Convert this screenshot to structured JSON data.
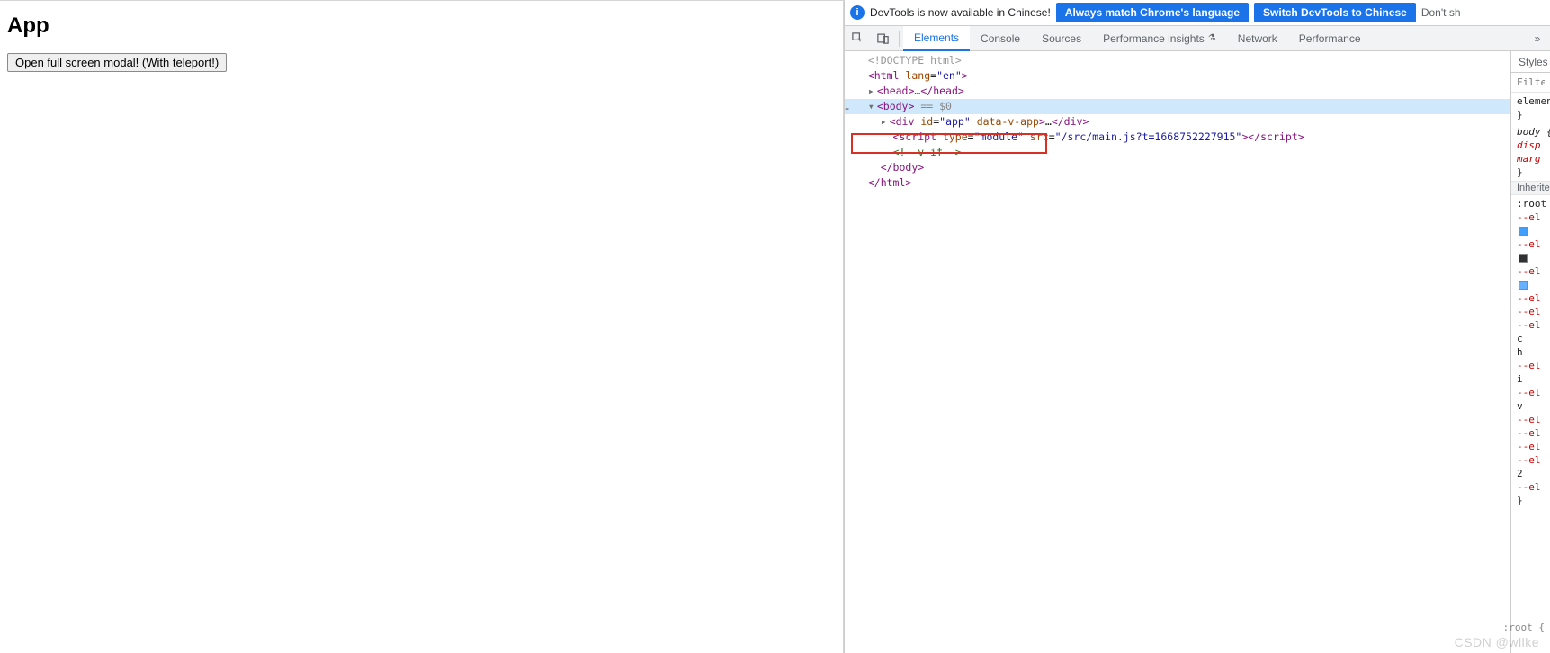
{
  "page": {
    "heading": "App",
    "open_modal_button": "Open full screen modal! (With teleport!)"
  },
  "infobar": {
    "message": "DevTools is now available in Chinese!",
    "always_match_button": "Always match Chrome's language",
    "switch_button": "Switch DevTools to Chinese",
    "dont_show": "Don't sh"
  },
  "toolbar": {
    "inspect_icon": "inspect",
    "device_icon": "device",
    "tabs": [
      {
        "label": "Elements",
        "active": true
      },
      {
        "label": "Console",
        "active": false
      },
      {
        "label": "Sources",
        "active": false
      },
      {
        "label": "Performance insights",
        "active": false,
        "badge": "flask"
      },
      {
        "label": "Network",
        "active": false
      },
      {
        "label": "Performance",
        "active": false
      }
    ]
  },
  "dom": {
    "doctype": "<!DOCTYPE html>",
    "html_open": "<html lang=\"en\">",
    "head": "<head>…</head>",
    "body_open": "<body>",
    "body_sel_suffix": " == $0",
    "app_div": "<div id=\"app\" data-v-app>…</div>",
    "script_line": "<script type=\"module\" src=\"/src/main.js?t=1668752227915\"></scr",
    "script_line_end": "ipt>",
    "vif_comment": "<!--v-if-->",
    "body_close": "</body>",
    "html_close": "</html>"
  },
  "styles": {
    "tab_label": "Styles",
    "filter_placeholder": "Filter",
    "element_style_label": "element",
    "body_selector": "body {",
    "body_prop1": "disp",
    "body_prop2": "marg",
    "inherited_label": "Inherited",
    "root_selector": ":root {",
    "vars": [
      "--el",
      "--el",
      "--el",
      "--el",
      "--el",
      "--el",
      "--el",
      "--el",
      "--el",
      "--el",
      "--el",
      "--el",
      "--el"
    ],
    "letters": [
      "c",
      "h",
      "i",
      "v",
      "2"
    ],
    "root_trail": ":root {"
  },
  "watermark": "CSDN @wllke"
}
